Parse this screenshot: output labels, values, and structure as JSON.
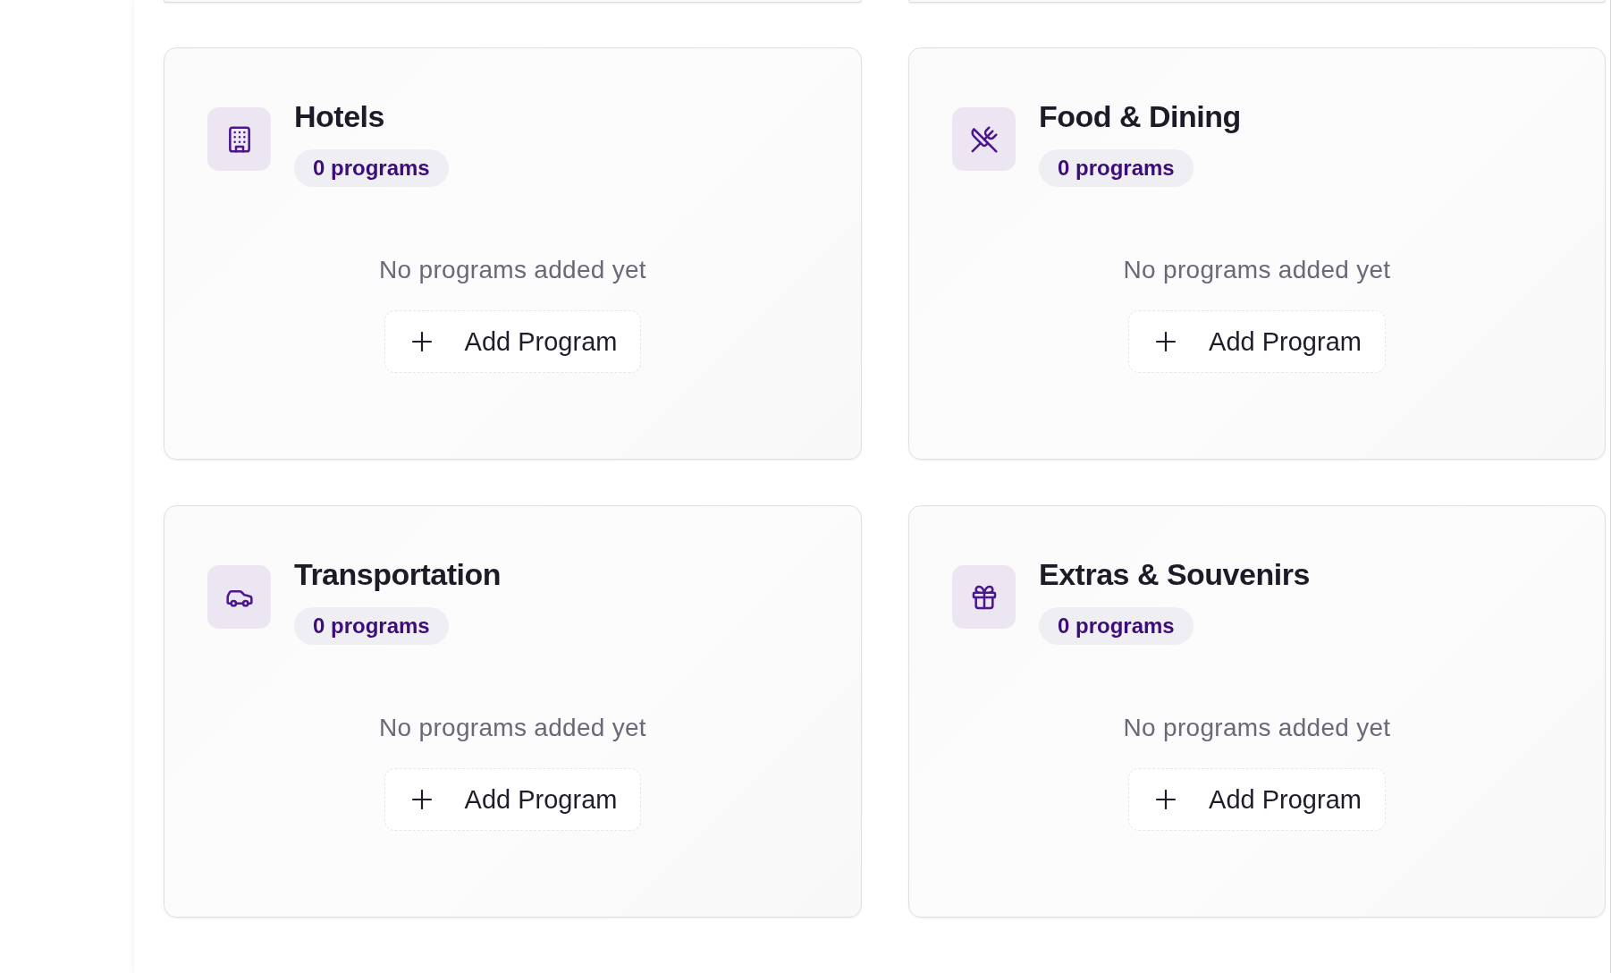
{
  "categories": [
    {
      "kind": "hotels",
      "title": "Hotels",
      "badge": "0 programs",
      "empty_message": "No programs added yet",
      "add_button": "Add Program"
    },
    {
      "kind": "dining",
      "title": "Food & Dining",
      "badge": "0 programs",
      "empty_message": "No programs added yet",
      "add_button": "Add Program"
    },
    {
      "kind": "transport",
      "title": "Transportation",
      "badge": "0 programs",
      "empty_message": "No programs added yet",
      "add_button": "Add Program"
    },
    {
      "kind": "extras",
      "title": "Extras & Souvenirs",
      "badge": "0 programs",
      "empty_message": "No programs added yet",
      "add_button": "Add Program"
    }
  ]
}
